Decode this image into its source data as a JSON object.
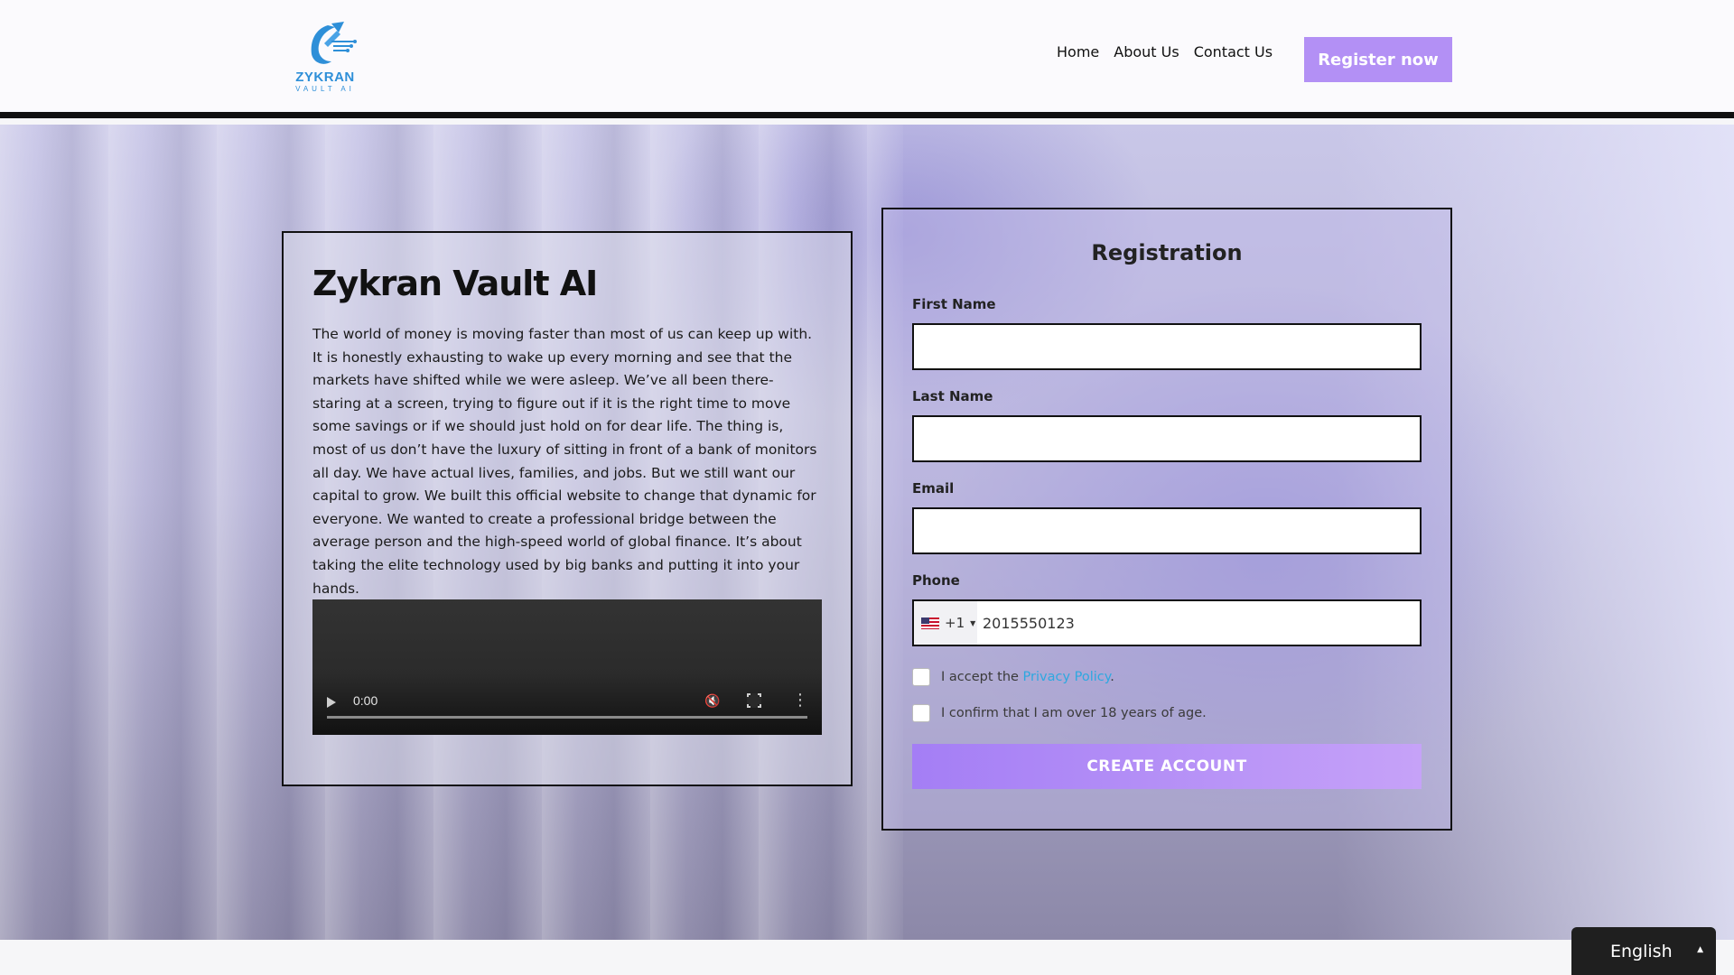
{
  "header": {
    "logo_name": "ZYKRAN",
    "logo_sub": "VAULT AI",
    "nav": [
      "Home",
      "About Us",
      "Contact Us"
    ],
    "register_label": "Register now",
    "brand_color": "#b390f5"
  },
  "info": {
    "title": "Zykran Vault AI",
    "text": "The world of money is moving faster than most of us can keep up with. It is honestly exhausting to wake up every morning and see that the markets have shifted while we were asleep. We’ve all been there-staring at a screen, trying to figure out if it is the right time to move some savings or if we should just hold on for dear life. The thing is, most of us don’t have the luxury of sitting in front of a bank of monitors all day. We have actual lives, families, and jobs. But we still want our capital to grow. We built this official website to change that dynamic for everyone. We wanted to create a professional bridge between the average person and the high-speed world of global finance. It’s about taking the elite technology used by big banks and putting it into your hands.",
    "video_time": "0:00"
  },
  "registration": {
    "title": "Registration",
    "first_name_label": "First Name",
    "last_name_label": "Last Name",
    "email_label": "Email",
    "phone_label": "Phone",
    "phone_code": "+1",
    "phone_value": "2015550123",
    "accept_prefix": "I accept the ",
    "privacy_link": "Privacy Policy",
    "accept_suffix": ".",
    "age_confirm": "I confirm that I am over 18 years of age.",
    "create_label": "CREATE ACCOUNT",
    "link_color": "#2ea8e0"
  },
  "language": {
    "selected": "English"
  }
}
